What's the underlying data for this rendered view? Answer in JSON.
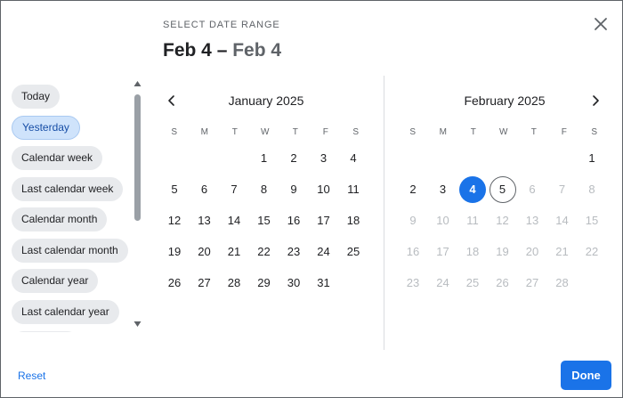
{
  "header": {
    "label": "SELECT DATE RANGE",
    "range_start": "Feb 4",
    "range_separator": " – ",
    "range_end": "Feb 4"
  },
  "presets": [
    {
      "label": "Today",
      "selected": false
    },
    {
      "label": "Yesterday",
      "selected": true
    },
    {
      "label": "Calendar week",
      "selected": false
    },
    {
      "label": "Last calendar week",
      "selected": false
    },
    {
      "label": "Calendar month",
      "selected": false
    },
    {
      "label": "Last calendar month",
      "selected": false
    },
    {
      "label": "Calendar year",
      "selected": false
    },
    {
      "label": "Last calendar year",
      "selected": false
    }
  ],
  "weekdays": [
    "S",
    "M",
    "T",
    "W",
    "T",
    "F",
    "S"
  ],
  "months": [
    {
      "name": "January 2025",
      "first_weekday": 3,
      "days_in_month": 31,
      "last_enabled_day": 31,
      "selected_day": null,
      "outlined_day": null
    },
    {
      "name": "February 2025",
      "first_weekday": 6,
      "days_in_month": 28,
      "last_enabled_day": 5,
      "selected_day": 4,
      "outlined_day": 5
    }
  ],
  "footer": {
    "reset_label": "Reset",
    "done_label": "Done"
  },
  "colors": {
    "accent": "#1a73e8",
    "chip_bg": "#e8eaed",
    "chip_selected_bg": "#cfe3fb",
    "disabled_text": "#b8bcc0"
  },
  "icons": {
    "close": "close-icon",
    "prev": "chevron-left-icon",
    "next": "chevron-right-icon",
    "scroll_up": "triangle-up-icon",
    "scroll_down": "triangle-down-icon"
  }
}
